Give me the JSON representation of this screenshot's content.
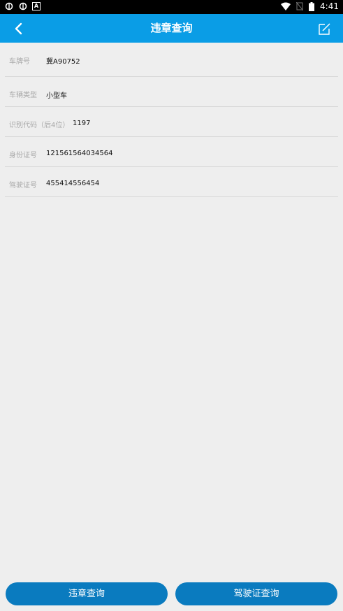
{
  "status_bar": {
    "time": "4:41",
    "left_icons": [
      "bug-icon",
      "bug-icon",
      "a-notification-icon"
    ],
    "right_icons": [
      "wifi-icon",
      "no-sim-icon",
      "battery-icon"
    ]
  },
  "app_bar": {
    "title": "违章查询",
    "background": "#0a9de6",
    "back_icon": "chevron-left-icon",
    "edit_icon": "edit-icon"
  },
  "form": {
    "rows": [
      {
        "label": "车牌号",
        "value": "冀A90752"
      },
      {
        "label": "车辆类型",
        "value": "小型车"
      },
      {
        "label": "识别代码（后4位）",
        "value": "1197"
      },
      {
        "label": "身份证号",
        "value": "121561564034564"
      },
      {
        "label": "驾驶证号",
        "value": "455414556454"
      }
    ]
  },
  "buttons": {
    "left_label": "违章查询",
    "right_label": "驾驶证查询",
    "color": "#0a7bbf"
  }
}
